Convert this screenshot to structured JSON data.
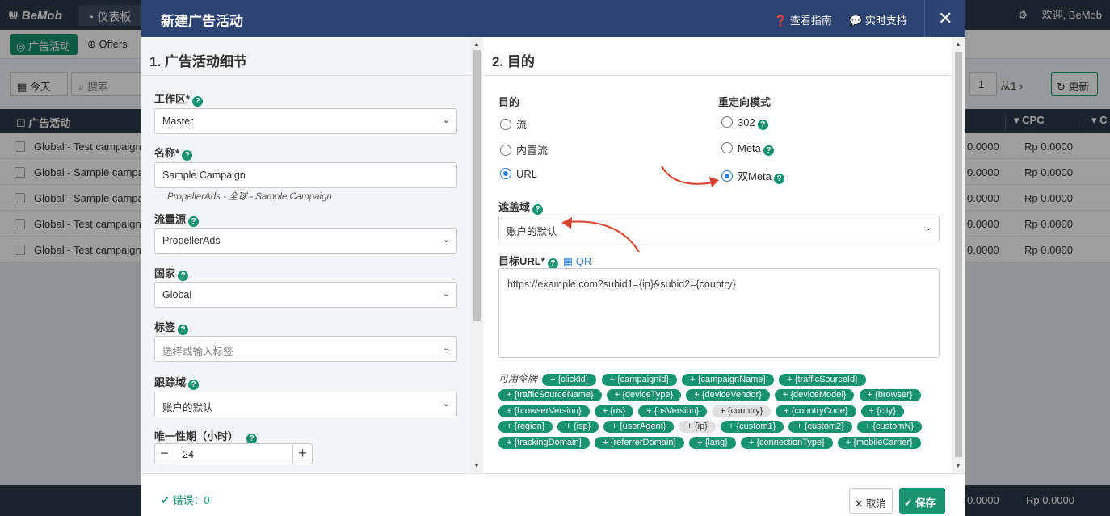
{
  "background": {
    "brand": "BeMob",
    "nav_tab": "仪表板",
    "user_greeting": "欢迎, BeMob",
    "sub_tabs": [
      "广告活动",
      "Offers"
    ],
    "date_button": "今天",
    "search_placeholder": "搜索",
    "page_number": "1",
    "page_suffix": "从1",
    "refresh_label": "更新",
    "column_campaign": "广告活动",
    "column_cpc": "CPC",
    "column_cut": "C",
    "rows": [
      {
        "name": "Global - Test campaign",
        "v1": "0.0000",
        "v2": "Rp 0.0000"
      },
      {
        "name": "Global - Sample campai",
        "v1": "0.0000",
        "v2": "Rp 0.0000"
      },
      {
        "name": "Global - Sample campai",
        "v1": "0.0000",
        "v2": "Rp 0.0000"
      },
      {
        "name": "Global - Test campaign",
        "v1": "0.0000",
        "v2": "Rp 0.0000"
      },
      {
        "name": "Global - Test campaign",
        "v1": "0.0000",
        "v2": "Rp 0.0000"
      }
    ],
    "footer_v1": "0.0000",
    "footer_v2": "Rp 0.0000"
  },
  "modal": {
    "title": "新建广告活动",
    "guide_link": "查看指南",
    "support_link": "实时支持",
    "close_symbol": "✕"
  },
  "left": {
    "section_title": "1. 广告活动细节",
    "workspace_label": "工作区*",
    "workspace_value": "Master",
    "name_label": "名称*",
    "name_value": "Sample Campaign",
    "name_hint": "PropellerAds - 全球 - Sample Campaign",
    "traffic_source_label": "流量源",
    "traffic_source_value": "PropellerAds",
    "country_label": "国家",
    "country_value": "Global",
    "tags_label": "标签",
    "tags_placeholder": "选择或输入标签",
    "tracking_domain_label": "跟踪域",
    "tracking_domain_value": "账户的默认",
    "uniqueness_label": "唯一性期（小时）",
    "uniqueness_value": "24"
  },
  "right": {
    "section_title": "2. 目的",
    "destination_label": "目的",
    "destination_options": [
      "流",
      "内置流",
      "URL"
    ],
    "destination_selected": "URL",
    "redirect_label": "重定向模式",
    "redirect_options": [
      "302",
      "Meta",
      "双Meta"
    ],
    "redirect_selected": "双Meta",
    "cover_domain_label": "遮盖域",
    "cover_domain_value": "账户的默认",
    "target_url_label": "目标URL*",
    "qr_label": "QR",
    "target_url_value": "https://example.com?subid1={ip}&subid2={country}",
    "tokens_label": "可用令牌",
    "tokens": [
      {
        "text": "+ {clickId}",
        "grey": false
      },
      {
        "text": "+ {campaignId}",
        "grey": false
      },
      {
        "text": "+ {campaignName}",
        "grey": false
      },
      {
        "text": "+ {trafficSourceId}",
        "grey": false
      },
      {
        "text": "+ {trafficSourceName}",
        "grey": false
      },
      {
        "text": "+ {deviceType}",
        "grey": false
      },
      {
        "text": "+ {deviceVendor}",
        "grey": false
      },
      {
        "text": "+ {deviceModel}",
        "grey": false
      },
      {
        "text": "+ {browser}",
        "grey": false
      },
      {
        "text": "+ {browserVersion}",
        "grey": false
      },
      {
        "text": "+ {os}",
        "grey": false
      },
      {
        "text": "+ {osVersion}",
        "grey": false
      },
      {
        "text": "+ {country}",
        "grey": true
      },
      {
        "text": "+ {countryCode}",
        "grey": false
      },
      {
        "text": "+ {city}",
        "grey": false
      },
      {
        "text": "+ {region}",
        "grey": false
      },
      {
        "text": "+ {isp}",
        "grey": false
      },
      {
        "text": "+ {userAgent}",
        "grey": false
      },
      {
        "text": "+ {ip}",
        "grey": true
      },
      {
        "text": "+ {custom1}",
        "grey": false
      },
      {
        "text": "+ {custom2}",
        "grey": false
      },
      {
        "text": "+ {customN}",
        "grey": false
      },
      {
        "text": "+ {trackingDomain}",
        "grey": false
      },
      {
        "text": "+ {referrerDomain}",
        "grey": false
      },
      {
        "text": "+ {lang}",
        "grey": false
      },
      {
        "text": "+ {connectionType}",
        "grey": false
      },
      {
        "text": "+ {mobileCarrier}",
        "grey": false
      }
    ]
  },
  "footer": {
    "errors_label": "错误：0",
    "cancel_label": "取消",
    "save_label": "保存"
  },
  "colors": {
    "header": "#2d4373",
    "accent": "#17946f",
    "radio": "#2f7fd6",
    "annotation_arrow": "#d9412f"
  }
}
